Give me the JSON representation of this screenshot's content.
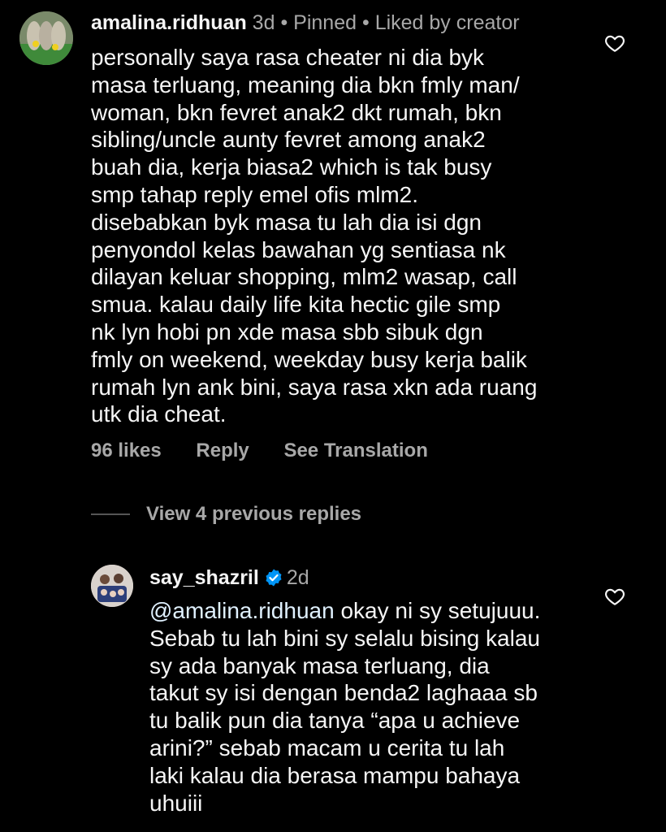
{
  "comment": {
    "username": "amalina.ridhuan",
    "time": "3d",
    "dot1": "•",
    "pinned": "Pinned",
    "dot2": "•",
    "liked_by": "Liked by creator",
    "lines": [
      "personally saya rasa cheater ni dia byk",
      "masa terluang, meaning dia bkn fmly man/",
      "woman, bkn fevret anak2 dkt rumah, bkn",
      "sibling/uncle aunty fevret among anak2",
      "buah dia, kerja biasa2 which is tak busy",
      "smp tahap reply emel ofis mlm2.",
      "disebabkan byk masa tu lah dia isi dgn",
      "penyondol kelas bawahan yg sentiasa nk",
      "dilayan keluar shopping, mlm2 wasap, call",
      "smua. kalau daily life kita hectic gile smp",
      "nk lyn hobi pn xde masa sbb sibuk dgn",
      "fmly on weekend, weekday busy kerja balik",
      "rumah lyn ank bini, saya rasa xkn ada ruang",
      "utk dia cheat."
    ],
    "likes": "96 likes",
    "reply": "Reply",
    "see_translation": "See Translation"
  },
  "view_replies": "View 4 previous replies",
  "reply": {
    "username": "say_shazril",
    "time": "2d",
    "mention": "@amalina.ridhuan",
    "first_line_rest": " okay ni sy setujuuu.",
    "lines": [
      "Sebab tu lah bini sy selalu bising kalau",
      "sy ada banyak masa terluang, dia",
      "takut sy isi dengan benda2 laghaaa sb",
      "tu balik pun dia tanya “apa u achieve",
      "arini?” sebab macam u cerita tu lah",
      "laki kalau dia berasa mampu bahaya",
      "uhuiii"
    ]
  },
  "icons": {
    "heart": "heart-outline-icon",
    "verified": "verified-badge-icon",
    "verified_color": "#0095f6"
  }
}
